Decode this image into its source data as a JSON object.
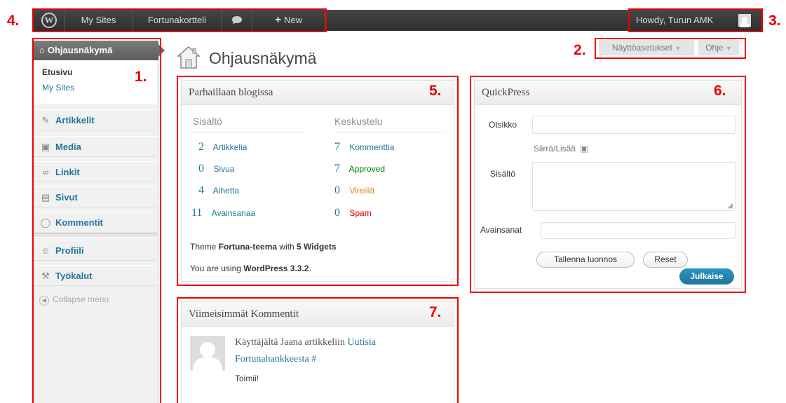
{
  "annotations": [
    "1.",
    "2.",
    "3.",
    "4.",
    "5.",
    "6.",
    "7."
  ],
  "admin_bar": {
    "wp_logo_icon": "wordpress-logo-icon",
    "my_sites": "My Sites",
    "site_name": "Fortunakortteli",
    "comments_icon": "speech-bubble-icon",
    "new_label": "New",
    "howdy": "Howdy, Turun AMK"
  },
  "sidebar": {
    "dashboard": "Ohjausnäkymä",
    "submenu": [
      "Etusivu",
      "My Sites"
    ],
    "items": [
      {
        "label": "Artikkelit",
        "icon": "pin-icon"
      },
      {
        "label": "Media",
        "icon": "media-icon"
      },
      {
        "label": "Linkit",
        "icon": "link-icon"
      },
      {
        "label": "Sivut",
        "icon": "pages-icon"
      },
      {
        "label": "Kommentit",
        "icon": "comment-icon"
      }
    ],
    "items2": [
      {
        "label": "Profiili",
        "icon": "users-icon"
      },
      {
        "label": "Työkalut",
        "icon": "tools-icon"
      }
    ],
    "collapse": "Collapse menu"
  },
  "header": {
    "title": "Ohjausnäkymä",
    "screen_options": "Näyttöasetukset",
    "help": "Ohje"
  },
  "right_now": {
    "title": "Parhaillaan blogissa",
    "col_content": "Sisältö",
    "col_discussion": "Keskustelu",
    "content": [
      {
        "num": "2",
        "label": "Artikkelia"
      },
      {
        "num": "0",
        "label": "Sivua"
      },
      {
        "num": "4",
        "label": "Aihetta"
      },
      {
        "num": "11",
        "label": "Avainsanaa"
      }
    ],
    "discussion": [
      {
        "num": "7",
        "label": "Kommenttia",
        "color": "#21759b"
      },
      {
        "num": "7",
        "label": "Approved",
        "color": "#008000"
      },
      {
        "num": "0",
        "label": "Vireillä",
        "color": "#d98500"
      },
      {
        "num": "0",
        "label": "Spam",
        "color": "#dd0000"
      }
    ],
    "theme_prefix": "Theme ",
    "theme_name": "Fortuna-teema",
    "theme_with": " with ",
    "widgets": "5 Widgets",
    "wp_prefix": "You are using ",
    "wp_version": "WordPress 3.3.2",
    "wp_suffix": "."
  },
  "quickpress": {
    "title": "QuickPress",
    "title_label": "Otsikko",
    "upload_label": "Siirrä/Lisää",
    "content_label": "Sisältö",
    "tags_label": "Avainsanat",
    "save_draft": "Tallenna luonnos",
    "reset": "Reset",
    "publish": "Julkaise"
  },
  "recent_comments": {
    "title": "Viimeisimmät Kommentit",
    "from": "Käyttäjältä Jaana artikkeliin ",
    "post_link": "Uutisia Fortunahankkeesta",
    "hash": "#",
    "excerpt": "Toimii!"
  },
  "colors": {
    "link": "#21759b",
    "annotation": "#ee0000",
    "primary_button": "#21759b"
  }
}
